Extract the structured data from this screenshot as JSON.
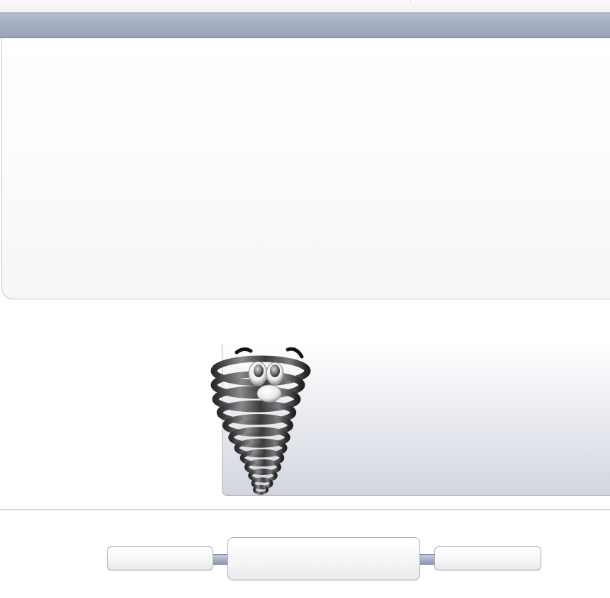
{
  "window": {
    "title": ""
  },
  "mascot": {
    "icon": "tornado-mascot-icon"
  },
  "navigation": {
    "left_label": "",
    "center_label": "",
    "right_label": ""
  },
  "colors": {
    "title_bar": "#a5adc1",
    "panel_bottom": "#d2d5df",
    "connector": "#8d97b1",
    "border": "#aeb0b6"
  }
}
